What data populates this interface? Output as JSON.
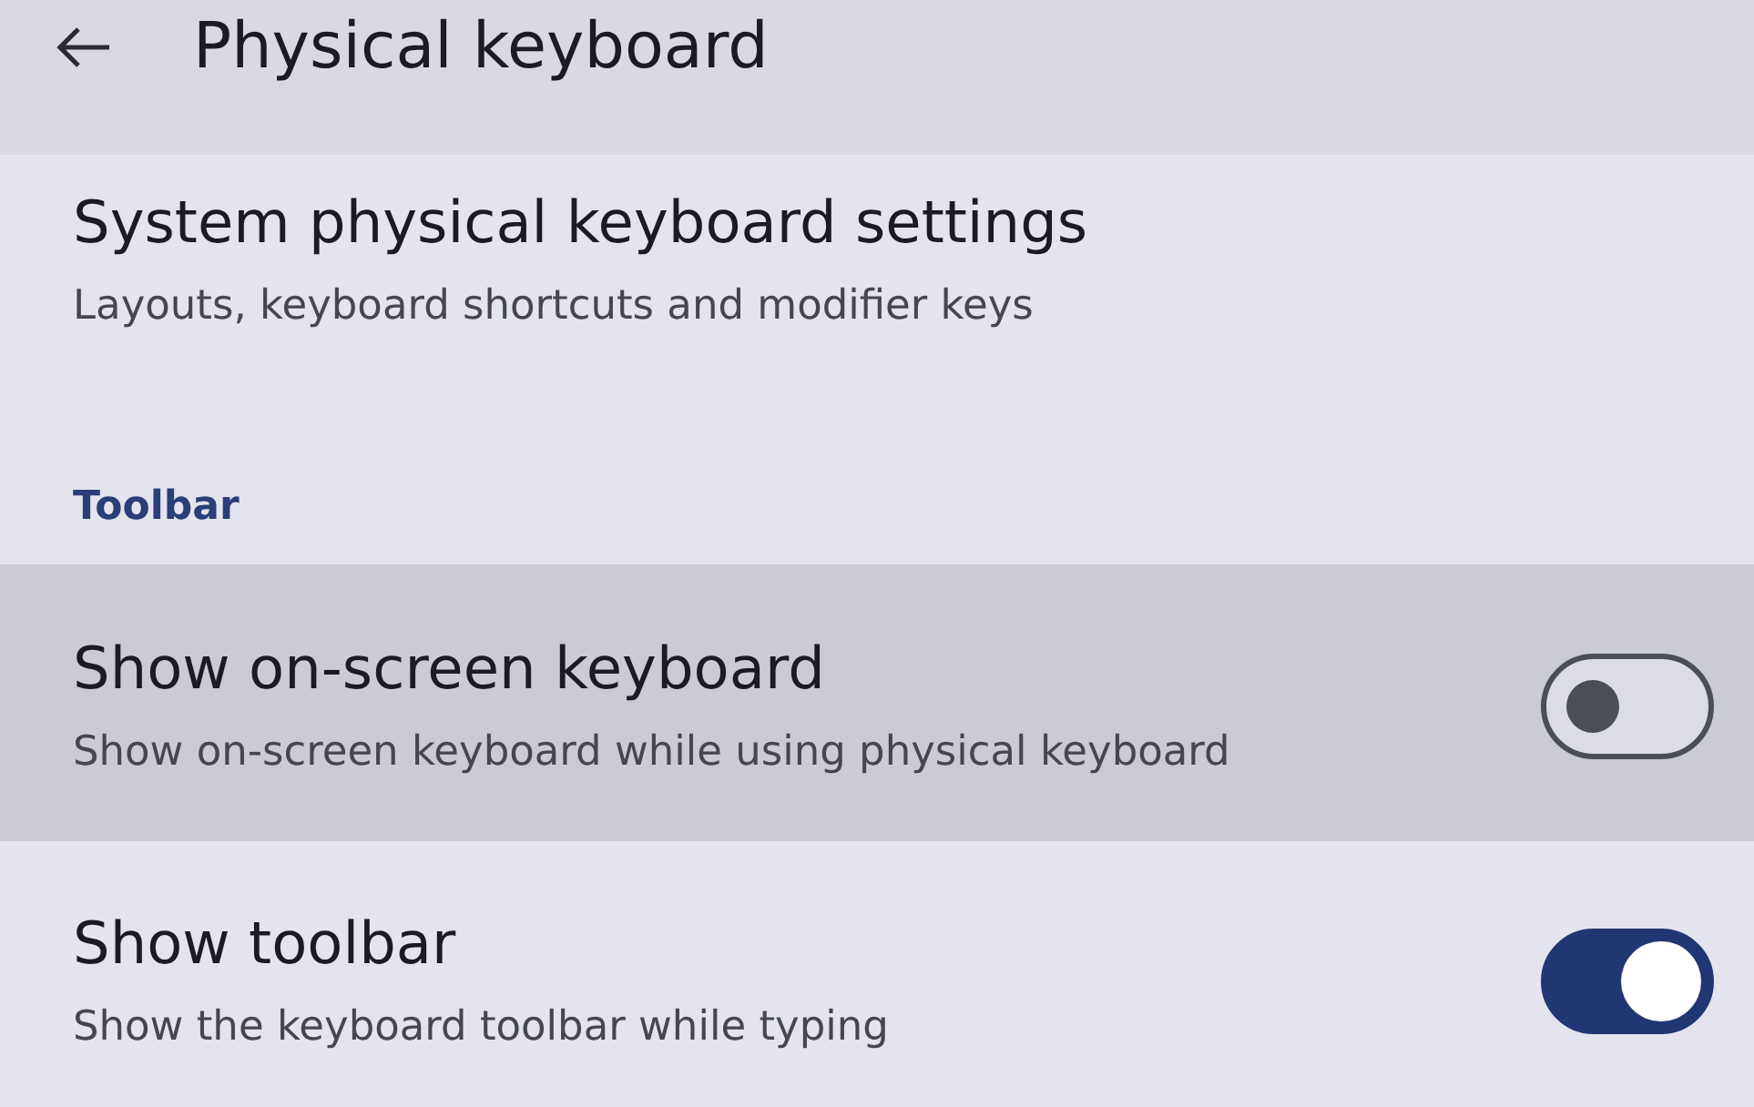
{
  "header": {
    "title": "Physical keyboard"
  },
  "items": [
    {
      "kind": "link",
      "title": "System physical keyboard settings",
      "summary": "Layouts, keyboard shortcuts and modifier keys"
    }
  ],
  "sections": [
    {
      "heading": "Toolbar",
      "items": [
        {
          "kind": "switch",
          "title": "Show on-screen keyboard",
          "summary": "Show on-screen keyboard while using physical keyboard",
          "on": false,
          "focused": true
        },
        {
          "kind": "switch",
          "title": "Show toolbar",
          "summary": "Show the keyboard toolbar while typing",
          "on": true,
          "focused": false
        }
      ]
    }
  ]
}
